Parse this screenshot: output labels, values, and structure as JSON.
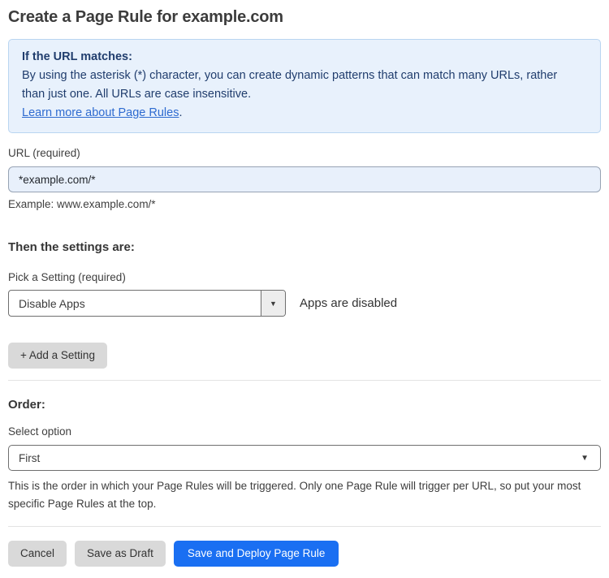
{
  "page": {
    "title": "Create a Page Rule for example.com"
  },
  "info_box": {
    "heading": "If the URL matches:",
    "body": "By using the asterisk (*) character, you can create dynamic patterns that can match many URLs, rather than just one. All URLs are case insensitive.",
    "link_label": "Learn more about Page Rules",
    "link_suffix": "."
  },
  "url_field": {
    "label": "URL (required)",
    "value": "*example.com/*",
    "helper": "Example: www.example.com/*"
  },
  "settings_section": {
    "heading": "Then the settings are:",
    "setting_label": "Pick a Setting (required)",
    "setting_value": "Disable Apps",
    "setting_status": "Apps are disabled",
    "add_setting_label": "+ Add a Setting"
  },
  "order_section": {
    "heading": "Order:",
    "select_label": "Select option",
    "select_value": "First",
    "help_text": "This is the order in which your Page Rules will be triggered. Only one Page Rule will trigger per URL, so put your most specific Page Rules at the top."
  },
  "actions": {
    "cancel_label": "Cancel",
    "save_draft_label": "Save as Draft",
    "save_deploy_label": "Save and Deploy Page Rule"
  },
  "icons": {
    "caret_down_glyph": "▼"
  },
  "colors": {
    "info_background": "#e8f1fc",
    "info_border": "#b9d5f1",
    "info_text": "#203d6d",
    "link_blue": "#2e6bd0",
    "input_background": "#e8f0fb",
    "primary_button_blue": "#1a6ff2",
    "secondary_button_gray": "#d9d9d9"
  }
}
